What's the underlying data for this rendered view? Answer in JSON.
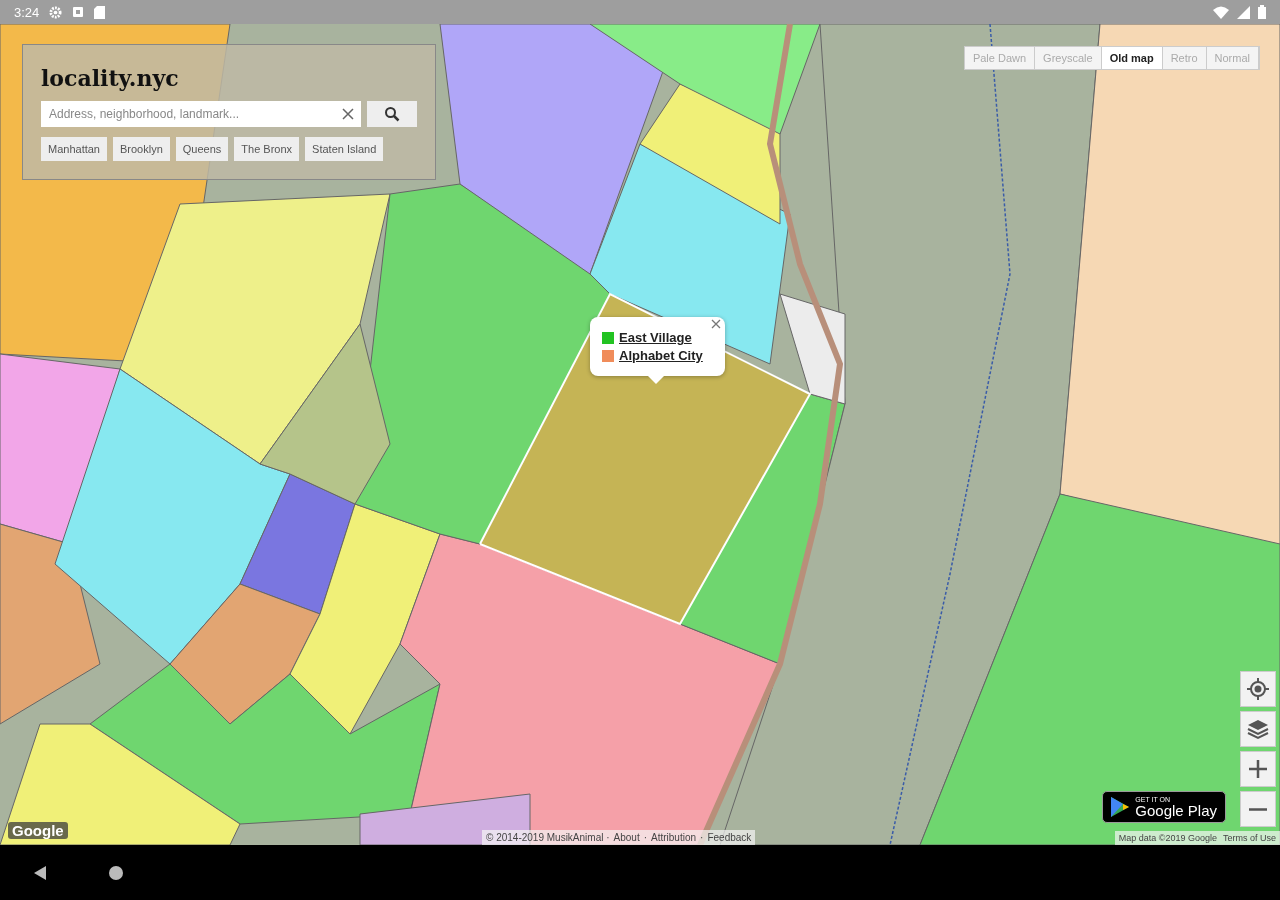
{
  "status_bar": {
    "time": "3:24"
  },
  "search_panel": {
    "title": "locality.nyc",
    "search": {
      "placeholder": "Address, neighborhood, landmark..."
    },
    "boroughs": [
      "Manhattan",
      "Brooklyn",
      "Queens",
      "The Bronx",
      "Staten Island"
    ]
  },
  "map_styles": [
    {
      "label": "Pale Dawn",
      "selected": false
    },
    {
      "label": "Greyscale",
      "selected": false
    },
    {
      "label": "Old map",
      "selected": true
    },
    {
      "label": "Retro",
      "selected": false
    },
    {
      "label": "Normal",
      "selected": false
    }
  ],
  "popup": {
    "items": [
      {
        "label": "East Village",
        "color": "#22c322"
      },
      {
        "label": "Alphabet City",
        "color": "#f08c5a"
      }
    ]
  },
  "map_logo": "Google",
  "attribution": {
    "text": "© 2014-2019 MusikAnimal ·",
    "links": [
      "About",
      "Attribution",
      "Feedback"
    ],
    "separator": "·"
  },
  "map_data": "Map data ©2019 Google",
  "terms": "Terms of Use",
  "store_badge": {
    "top": "GET IT ON",
    "bottom": "Google Play"
  }
}
